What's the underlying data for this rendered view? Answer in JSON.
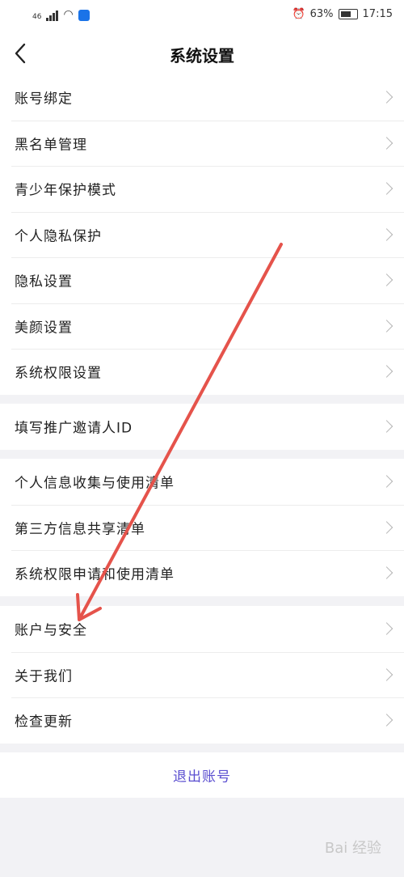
{
  "status_bar": {
    "network": "46",
    "battery": "63%",
    "time": "17:15"
  },
  "header": {
    "title": "系统设置"
  },
  "groups": [
    {
      "items": [
        {
          "label": "账号绑定"
        },
        {
          "label": "黑名单管理"
        },
        {
          "label": "青少年保护模式"
        },
        {
          "label": "个人隐私保护"
        },
        {
          "label": "隐私设置"
        },
        {
          "label": "美颜设置"
        },
        {
          "label": "系统权限设置"
        }
      ]
    },
    {
      "items": [
        {
          "label": "填写推广邀请人ID"
        }
      ]
    },
    {
      "items": [
        {
          "label": "个人信息收集与使用清单"
        },
        {
          "label": "第三方信息共享清单"
        },
        {
          "label": "系统权限申请和使用清单"
        }
      ]
    },
    {
      "items": [
        {
          "label": "账户与安全"
        },
        {
          "label": "关于我们"
        },
        {
          "label": "检查更新"
        }
      ]
    }
  ],
  "logout": {
    "label": "退出账号"
  },
  "colors": {
    "accent": "#5b4fd0",
    "annotation_arrow": "#e5534b",
    "background": "#f2f2f5"
  },
  "watermark": "Bai 经验"
}
